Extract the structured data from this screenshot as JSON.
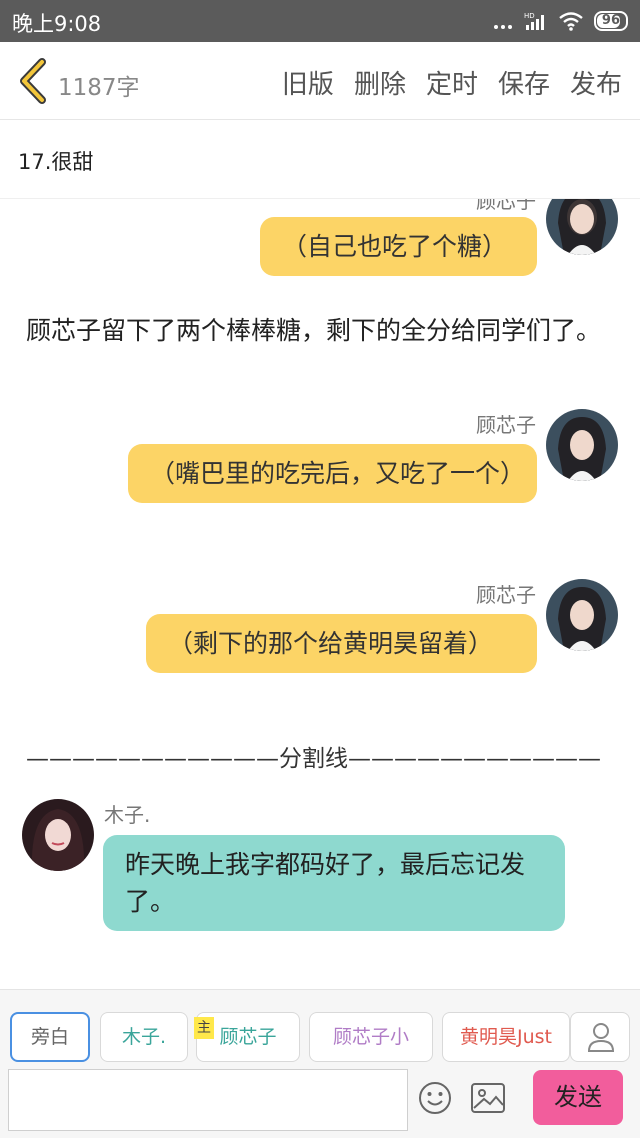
{
  "status_bar": {
    "time": "晚上9:08",
    "battery": "96",
    "network": "HD"
  },
  "header": {
    "word_count": "1187字",
    "actions": [
      "旧版",
      "删除",
      "定时",
      "保存",
      "发布"
    ]
  },
  "chapter": {
    "title": "17.很甜"
  },
  "messages": [
    {
      "type": "bubble",
      "side": "right",
      "sender": "顾芯子",
      "text": "（自己也吃了个糖）",
      "color": "#fcd466"
    },
    {
      "type": "narration",
      "text": "顾芯子留下了两个棒棒糖，剩下的全分给同学们了。"
    },
    {
      "type": "bubble",
      "side": "right",
      "sender": "顾芯子",
      "text": "（嘴巴里的吃完后，又吃了一个）",
      "color": "#fcd466"
    },
    {
      "type": "bubble",
      "side": "right",
      "sender": "顾芯子",
      "text": "（剩下的那个给黄明昊留着）",
      "color": "#fcd466"
    },
    {
      "type": "divider",
      "text": "———————————分割线———————————"
    },
    {
      "type": "bubble",
      "side": "left",
      "sender": "木子.",
      "text": "昨天晚上我字都码好了，最后忘记发了。",
      "color": "#8ed9cf"
    }
  ],
  "roles": [
    {
      "label": "旁白",
      "color": "#666666",
      "selected": true
    },
    {
      "label": "木子.",
      "color": "#3aa59a",
      "selected": false
    },
    {
      "label": "顾芯子",
      "color": "#3aa59a",
      "selected": false,
      "badge": "主"
    },
    {
      "label": "顾芯子小",
      "color": "#b07cc6",
      "selected": false
    },
    {
      "label": "黄明昊Just",
      "color": "#e05a4f",
      "selected": false
    }
  ],
  "composer": {
    "placeholder": "",
    "send_label": "发送"
  },
  "icons": {
    "back": "chevron-left-icon",
    "user": "user-icon",
    "emoji": "emoji-icon",
    "image": "image-icon"
  }
}
